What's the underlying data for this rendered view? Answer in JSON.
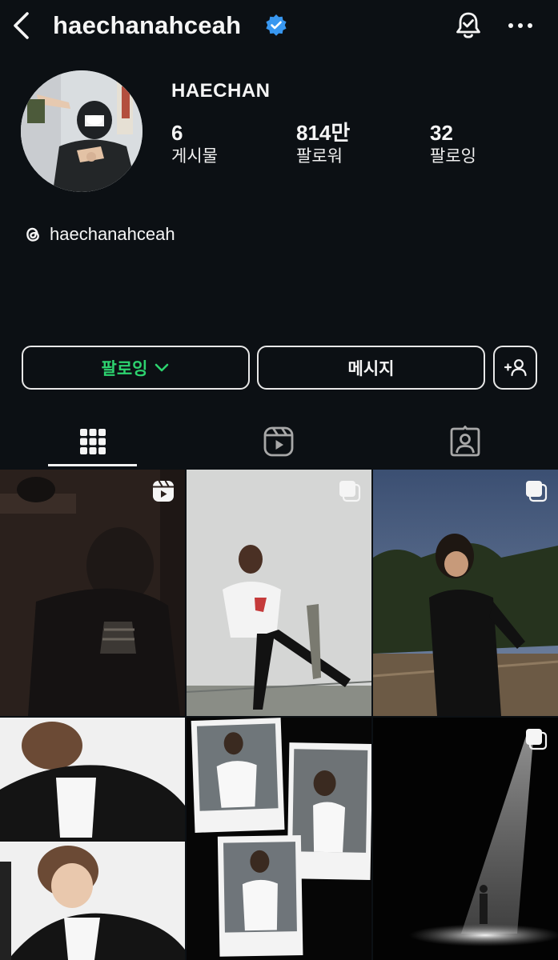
{
  "header": {
    "username": "haechanahceah",
    "icons": {
      "back": "chevron-left-icon",
      "verified": "verified-badge-icon",
      "notifications": "bell-check-icon",
      "more": "more-horizontal-icon"
    }
  },
  "profile": {
    "display_name": "HAECHAN",
    "stats": {
      "posts": {
        "value": "6",
        "label": "게시물"
      },
      "followers": {
        "value": "814만",
        "label": "팔로워"
      },
      "following": {
        "value": "32",
        "label": "팔로잉"
      }
    },
    "threads_handle": "haechanahceah"
  },
  "actions": {
    "following_label": "팔로잉",
    "message_label": "메시지"
  },
  "tabs": [
    {
      "name": "posts",
      "icon": "grid-icon",
      "active": true
    },
    {
      "name": "reels",
      "icon": "reels-icon",
      "active": false
    },
    {
      "name": "tagged",
      "icon": "tagged-user-icon",
      "active": false
    }
  ],
  "colors": {
    "background": "#0c1014",
    "following_accent": "#2dd36f",
    "verified_blue": "#3897f0"
  },
  "grid": [
    {
      "type": "reel",
      "badge": "reel-icon"
    },
    {
      "type": "carousel",
      "badge": "carousel-icon"
    },
    {
      "type": "carousel",
      "badge": "carousel-icon"
    },
    {
      "type": "photo",
      "badge": ""
    },
    {
      "type": "photo",
      "badge": ""
    },
    {
      "type": "carousel",
      "badge": "carousel-icon"
    }
  ]
}
